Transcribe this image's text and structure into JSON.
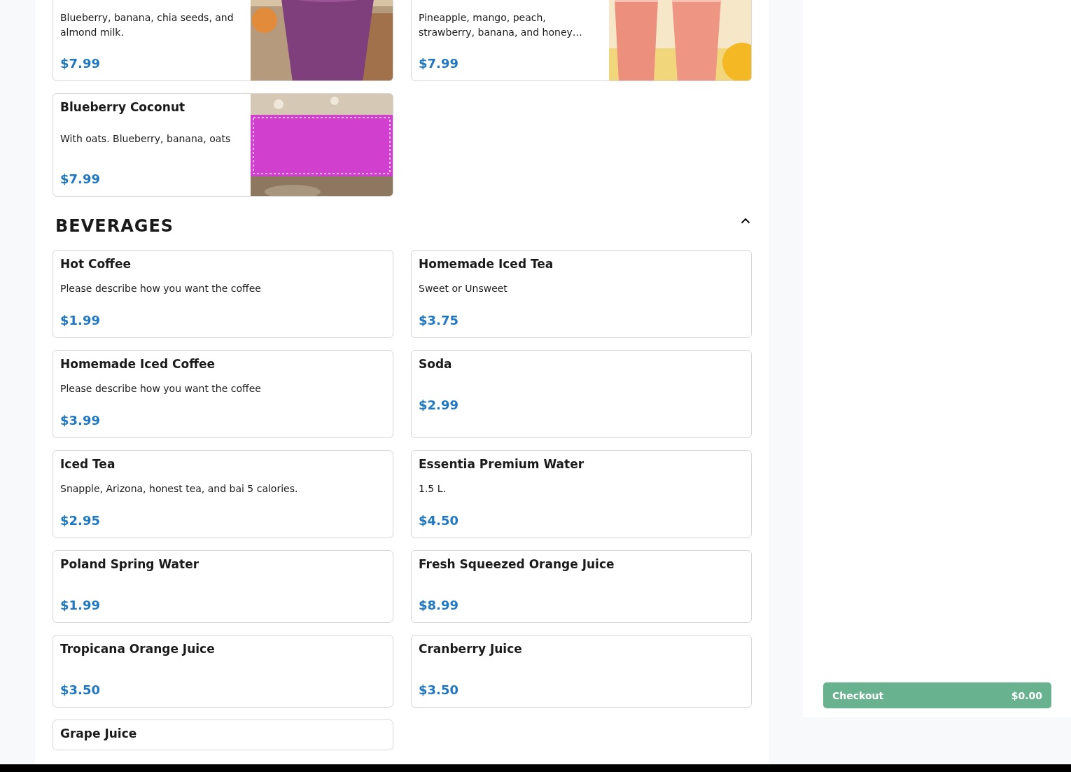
{
  "sections": [
    {
      "items": [
        {
          "description": "Blueberry, banana, chia seeds, and almond milk.",
          "price": "$7.99"
        },
        {
          "description": "Pineapple, mango, peach, strawberry, banana, and honey…",
          "price": "$7.99"
        },
        {
          "name": "Blueberry Coconut",
          "description": "With oats. Blueberry, banana, oats",
          "price": "$7.99"
        }
      ]
    },
    {
      "title": "BEVERAGES",
      "expanded": true,
      "items": [
        {
          "name": "Hot Coffee",
          "description": "Please describe how you want the coffee",
          "price": "$1.99"
        },
        {
          "name": "Homemade Iced Tea",
          "description": "Sweet or Unsweet",
          "price": "$3.75"
        },
        {
          "name": "Homemade Iced Coffee",
          "description": "Please describe how you want the coffee",
          "price": "$3.99"
        },
        {
          "name": "Soda",
          "price": "$2.99"
        },
        {
          "name": "Iced Tea",
          "description": "Snapple, Arizona, honest tea, and bai 5 calories.",
          "price": "$2.95"
        },
        {
          "name": "Essentia Premium Water",
          "description": "1.5 L.",
          "price": "$4.50"
        },
        {
          "name": "Poland Spring Water",
          "price": "$1.99"
        },
        {
          "name": "Fresh Squeezed Orange Juice",
          "price": "$8.99"
        },
        {
          "name": "Tropicana Orange Juice",
          "price": "$3.50"
        },
        {
          "name": "Cranberry Juice",
          "price": "$3.50"
        },
        {
          "name": "Grape Juice"
        }
      ]
    }
  ],
  "checkout": {
    "label": "Checkout",
    "total": "$0.00"
  }
}
